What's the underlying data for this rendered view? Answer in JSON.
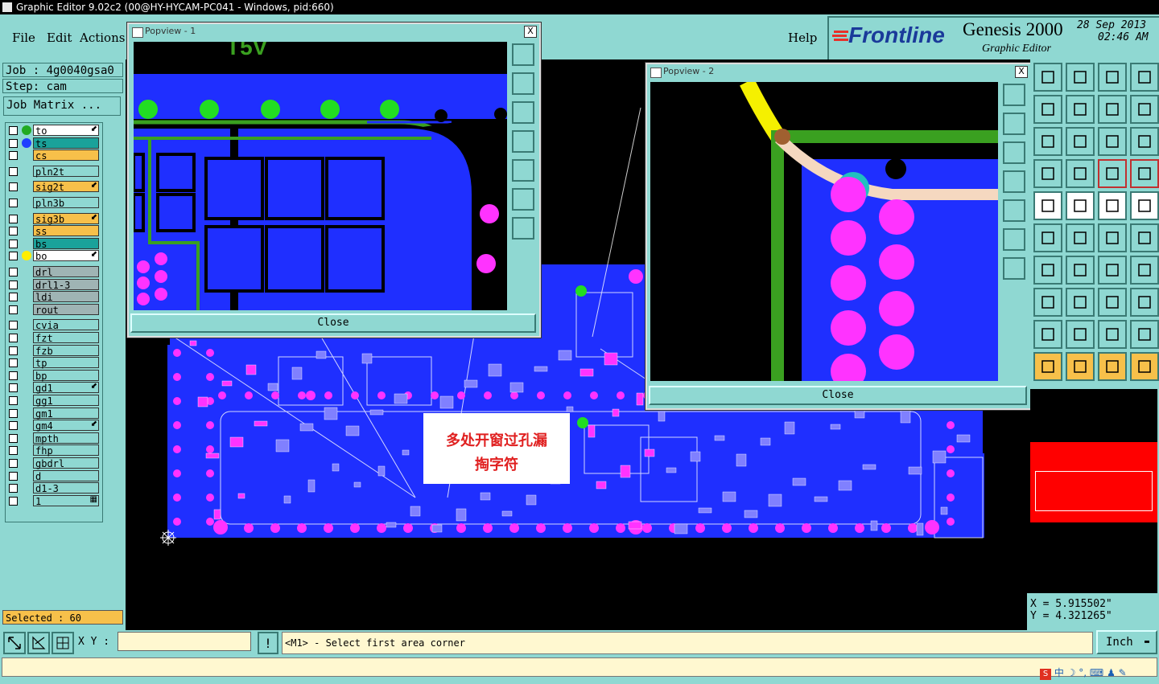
{
  "titlebar": {
    "text": "Graphic Editor 9.02c2 (00@HY-HYCAM-PC041 - Windows, pid:660)"
  },
  "menu": {
    "file": "File",
    "edit": "Edit",
    "actions": "Actions",
    "help": "Help"
  },
  "brand": {
    "logo": "Frontline",
    "product": "Genesis 2000",
    "subtitle": "Graphic Editor",
    "date": "28 Sep 2013",
    "time": "02:46 AM"
  },
  "job": {
    "job_label": "Job : 4g0040gsa0",
    "step_label": "Step: cam",
    "matrix_button": "Job Matrix ..."
  },
  "layers": [
    {
      "name": "to",
      "color": "#ffffff",
      "dot": "#22aa22",
      "flag": "⬋"
    },
    {
      "name": "ts",
      "color": "#1aa29a",
      "dot": "#1f3fff",
      "flag": ""
    },
    {
      "name": "cs",
      "color": "#f7c04a",
      "dot": "",
      "flag": ""
    },
    {
      "name": "pln2t",
      "color": "#8fd8d2",
      "dot": "",
      "flag": ""
    },
    {
      "name": "sig2t",
      "color": "#f7c04a",
      "dot": "",
      "flag": "⬋"
    },
    {
      "name": "pln3b",
      "color": "#8fd8d2",
      "dot": "",
      "flag": ""
    },
    {
      "name": "sig3b",
      "color": "#f7c04a",
      "dot": "",
      "flag": "⬋"
    },
    {
      "name": "ss",
      "color": "#f7c04a",
      "dot": "",
      "flag": ""
    },
    {
      "name": "bs",
      "color": "#1aa29a",
      "dot": "",
      "flag": ""
    },
    {
      "name": "bo",
      "color": "#ffffff",
      "dot": "#ffee00",
      "flag": "⬋"
    },
    {
      "name": "drl",
      "color": "#9fb4b4",
      "dot": "",
      "flag": ""
    },
    {
      "name": "drl1-3",
      "color": "#9fb4b4",
      "dot": "",
      "flag": ""
    },
    {
      "name": "ldi",
      "color": "#9fb4b4",
      "dot": "",
      "flag": ""
    },
    {
      "name": "rout",
      "color": "#9fb4b4",
      "dot": "",
      "flag": ""
    },
    {
      "name": "cvia",
      "color": "#8fd8d2",
      "dot": "",
      "flag": ""
    },
    {
      "name": "fzt",
      "color": "#8fd8d2",
      "dot": "",
      "flag": ""
    },
    {
      "name": "fzb",
      "color": "#8fd8d2",
      "dot": "",
      "flag": ""
    },
    {
      "name": "tp",
      "color": "#8fd8d2",
      "dot": "",
      "flag": ""
    },
    {
      "name": "bp",
      "color": "#8fd8d2",
      "dot": "",
      "flag": ""
    },
    {
      "name": "gd1",
      "color": "#8fd8d2",
      "dot": "",
      "flag": "⬋"
    },
    {
      "name": "gg1",
      "color": "#8fd8d2",
      "dot": "",
      "flag": ""
    },
    {
      "name": "gm1",
      "color": "#8fd8d2",
      "dot": "",
      "flag": ""
    },
    {
      "name": "gm4",
      "color": "#8fd8d2",
      "dot": "",
      "flag": "⬋"
    },
    {
      "name": "mpth",
      "color": "#8fd8d2",
      "dot": "",
      "flag": ""
    },
    {
      "name": "fhp",
      "color": "#8fd8d2",
      "dot": "",
      "flag": ""
    },
    {
      "name": "gbdrl",
      "color": "#8fd8d2",
      "dot": "",
      "flag": ""
    },
    {
      "name": "d",
      "color": "#8fd8d2",
      "dot": "",
      "flag": ""
    },
    {
      "name": "d1-3",
      "color": "#8fd8d2",
      "dot": "",
      "flag": ""
    },
    {
      "name": "1",
      "color": "#8fd8d2",
      "dot": "",
      "flag": "▦"
    }
  ],
  "selected": "Selected : 60",
  "popview1": {
    "title": "Popview - 1",
    "close": "Close",
    "close_x": "X",
    "board_text": "T5V"
  },
  "popview2": {
    "title": "Popview - 2",
    "close": "Close",
    "close_x": "X"
  },
  "annotation": {
    "line1": "多处开窗过孔漏",
    "line2": "掏字符"
  },
  "coords": {
    "x": "X =  5.915502\"",
    "y": "Y =  4.321265\""
  },
  "bottom": {
    "xy_label": "X Y :",
    "xy_value": "",
    "status": "<M1> - Select first area corner",
    "units": "Inch",
    "warn": "!"
  },
  "colors": {
    "board": "#1f2fff",
    "pad": "#ff33ff",
    "trace": "#3aa020",
    "canvas": "#000000",
    "panel": "#8fd8d2"
  }
}
